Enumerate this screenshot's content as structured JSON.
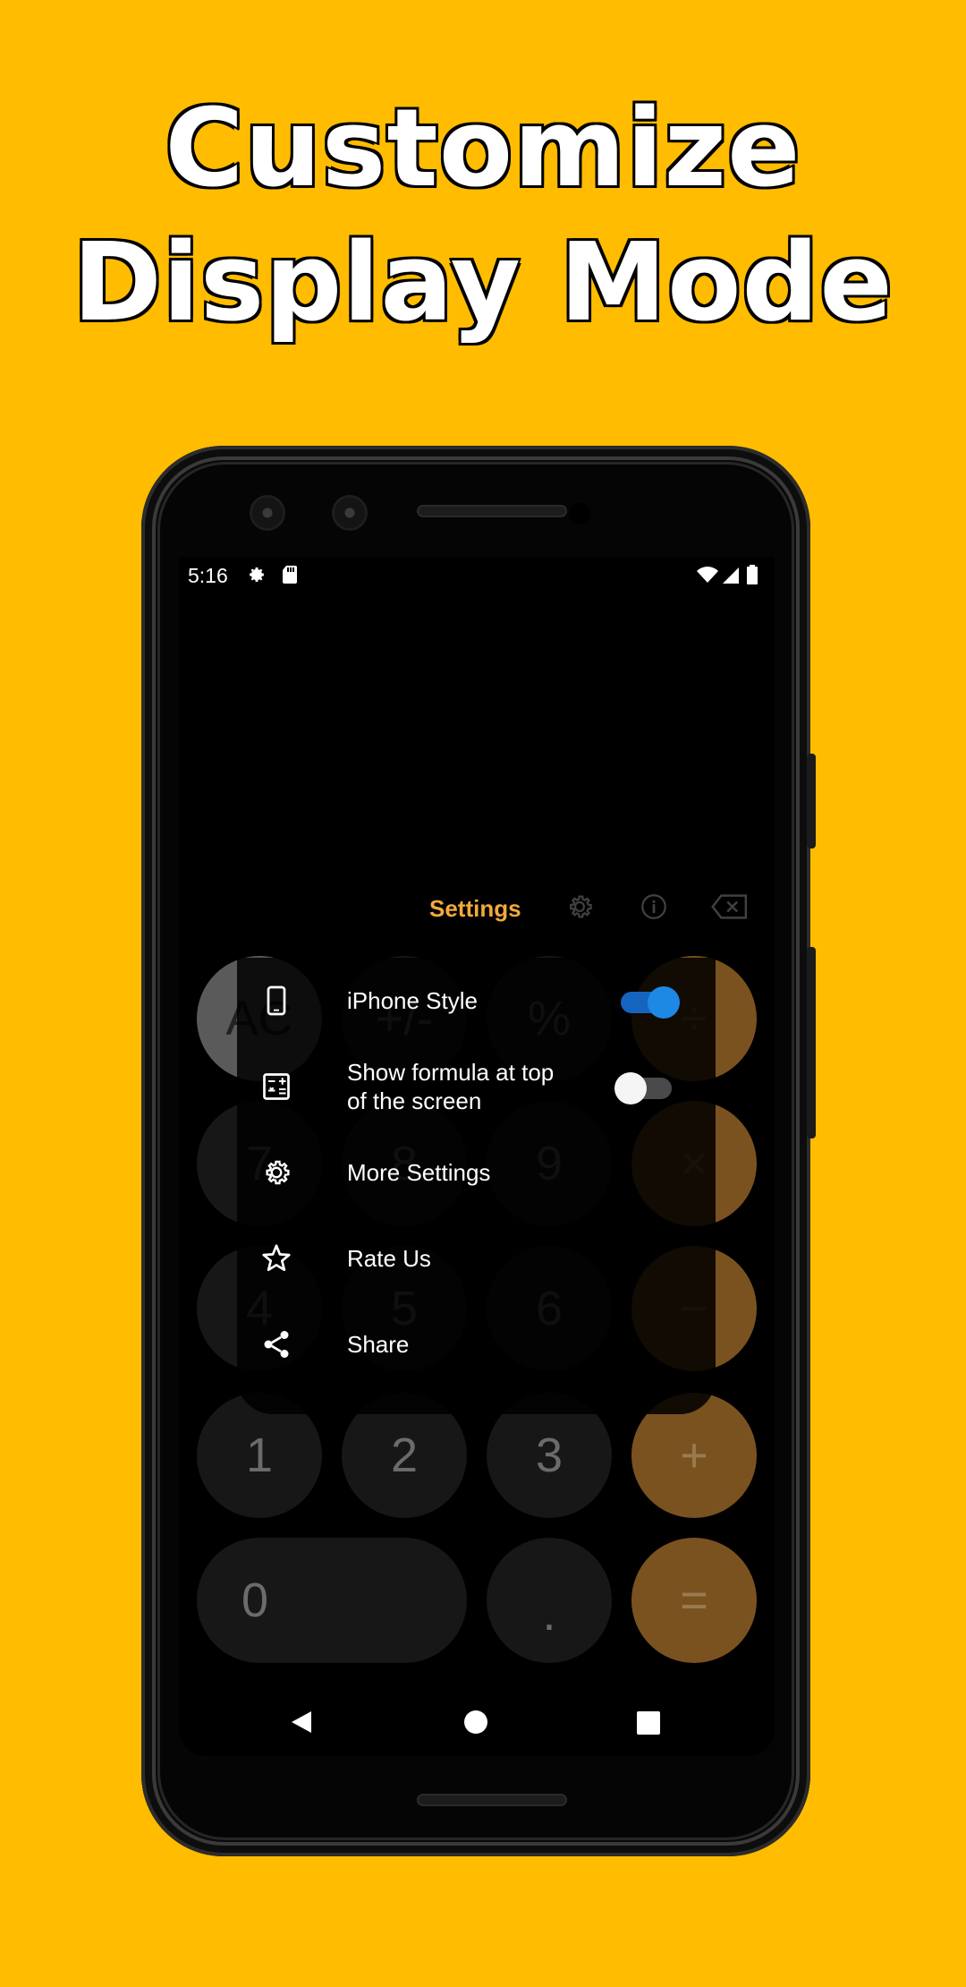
{
  "headline": {
    "line1": "Customize",
    "line2": "Display Mode"
  },
  "status_bar": {
    "time": "5:16",
    "icons": [
      "gear-icon",
      "sd-card-icon",
      "wifi-icon",
      "signal-icon",
      "battery-icon"
    ]
  },
  "toolbar": {
    "title": "Settings",
    "icons": [
      "gear-icon",
      "info-icon",
      "backspace-icon"
    ]
  },
  "keypad": {
    "row1": [
      "AC",
      "+/-",
      "%",
      "÷"
    ],
    "row2": [
      "7",
      "8",
      "9",
      "×"
    ],
    "row3": [
      "4",
      "5",
      "6",
      "−"
    ],
    "row4": [
      "1",
      "2",
      "3",
      "+"
    ],
    "row5": [
      "0",
      ".",
      "="
    ]
  },
  "menu": {
    "items": [
      {
        "label": "iPhone Style",
        "icon": "phone-icon",
        "toggle": true,
        "toggle_on": true
      },
      {
        "label": "Show formula at top of the screen",
        "label_line1": "Show formula at top",
        "label_line2": "of the screen",
        "icon": "calculator-icon",
        "toggle": true,
        "toggle_on": false
      },
      {
        "label": "More Settings",
        "icon": "gear-icon",
        "toggle": false
      },
      {
        "label": "Rate Us",
        "icon": "star-icon",
        "toggle": false
      },
      {
        "label": "Share",
        "icon": "share-icon",
        "toggle": false
      }
    ]
  },
  "colors": {
    "background": "#FFBC00",
    "accent_orange": "#F3A93A",
    "toggle_blue": "#1E88E5"
  }
}
